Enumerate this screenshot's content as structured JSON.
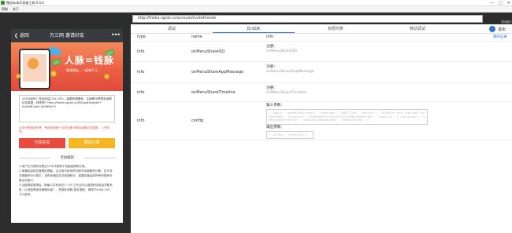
{
  "window": {
    "title": "微信web开发者工具 0.4.0",
    "controls": [
      "—",
      "□",
      "✕"
    ]
  },
  "menubar": {
    "items": [
      "帮助",
      "关于"
    ]
  },
  "phone": {
    "back_label": "❮ 返回",
    "title": "万三网 邀请好友",
    "more_label": "•••",
    "banner_headline": "人脉=钱脉",
    "banner_sub": "邀请朋友，一起拿千元",
    "copy_text": "100%返利！将出收益12%-15%，金额来源借来，注册即可获得手续费红包奖励，快来吧！http://fredia.ngrok.cc/B2/go#register?inviteBCode=8z56Pq7U",
    "notice": "点击分享按钮分享，有成功邀请一位好友即可得手续费红包奖励，上不封顶。",
    "share_button": "分享好友",
    "record_button": "邀请记录",
    "rules_title": "活动规则",
    "rules": [
      "1.用户在可用积分数达10天才能够于初始邀请积分赏。",
      "2.单通知返除在管理处理者，企业用可用来积分即可持被赠积分累，且不非法现象积分计算中，自布收通过在次前请积分，如果在最后的所有所的积分提出次用户。",
      "3.当邀请奖赏清后，换最人员有效在1~3个工作日内以邀请好成电话式联系您（以您能明填写情确为准），誓使补收剩 相关请帐，请拨打4008-205-155咨询。"
    ]
  },
  "address_bar": {
    "url": "http://fredia.ngrok.cc/account/inviteFriends",
    "clear_label": "清除缓存"
  },
  "tabs": [
    {
      "label": "调试",
      "active": false
    },
    {
      "label": "JS-SDK",
      "active": true
    },
    {
      "label": "权限列表",
      "active": false
    },
    {
      "label": "移动调试",
      "active": false
    }
  ],
  "logout_label": "退出",
  "table": {
    "headers": {
      "type": "type",
      "name": "name",
      "info": "info"
    },
    "clear_log": "清除记录",
    "rows": [
      {
        "type": "info",
        "name": "onMenuShareQQ",
        "info_label": "注册：",
        "info_value": "onMenuShareQQ"
      },
      {
        "type": "info",
        "name": "onMenuShareAppMessage",
        "info_label": "注册：",
        "info_value": "onMenuShareAppMessage"
      },
      {
        "type": "info",
        "name": "onMenuShareTimeline",
        "info_label": "注册：",
        "info_value": "onMenuShareTimeline"
      }
    ],
    "config_row": {
      "type": "info",
      "name": "config",
      "input_label": "输入参数：",
      "input_code": "{ \"appId\": \"wx6b9630e524fecc6\", \"timestamp\": \"1486117240\", \"nonceStr\": \"4220b3c3f-e5c3-4f0d-9807-bce6ce5c9a64\", \"signature\": \"d5e9e6b063f52e4b7df2fa7ffd5a6f990d80f4ae\", \"jsApiList\": [ \"checkJsApi\", \"onMenuShareTimeline\", \"onMenuShareAppMessage\", \"onMenuShareQQ\" ] }",
      "output_label": "输出参数：",
      "output_code": "{ \"errMsg\": \"config:ok\" }"
    }
  },
  "colors": {
    "accent": "#3b7ddd",
    "share_button": "#e94b3c",
    "record_button": "#f5b622",
    "dark_bg": "#2d2d2d"
  }
}
